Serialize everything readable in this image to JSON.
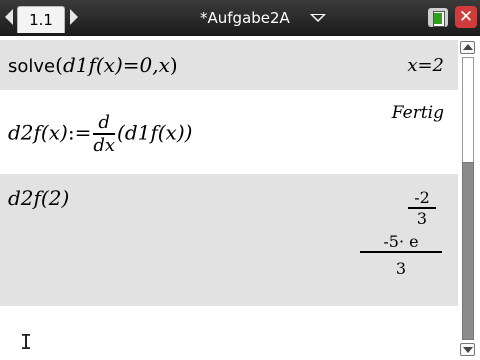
{
  "titlebar": {
    "tab_label": "1.1",
    "document_title": "*Aufgabe2A"
  },
  "rows": [
    {
      "input_fn": "solve",
      "input_open": "(",
      "input_expr": "d1f(x)=0,x",
      "input_close": ")",
      "output": "x=2"
    },
    {
      "input_lhs": "d2f(x)",
      "input_assign": ":=",
      "deriv_num": "d",
      "deriv_den": "dx",
      "input_arg": "(d1f(x))",
      "output": "Fertig"
    },
    {
      "input": "d2f(2)",
      "output1_num": "-2",
      "output1_den": "3",
      "output2_num": "-5· e",
      "output2_den": "3"
    }
  ],
  "icons": {
    "battery": "battery-icon",
    "close": "close-icon",
    "cursor": "text-cursor-icon"
  },
  "colors": {
    "titlebar": "#2a2a2a",
    "row_gray": "#e2e2e2",
    "close_red": "#d13b3b",
    "battery_green": "#2fa020"
  }
}
